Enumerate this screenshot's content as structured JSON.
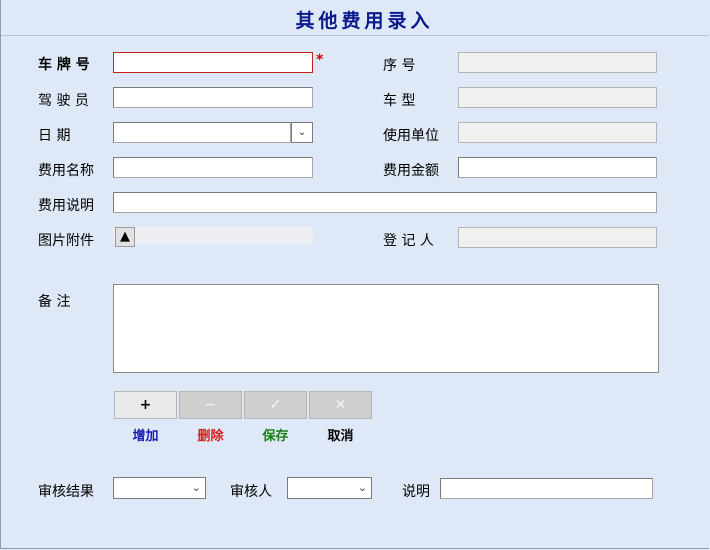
{
  "form": {
    "title": "其他费用录入",
    "fields": {
      "plate_label": "车 牌 号",
      "plate_required_mark": "*",
      "seq_label": "序    号",
      "driver_label": "驾 驶 员",
      "vehicle_type_label": "车    型",
      "date_label": "日    期",
      "user_unit_label": "使用单位",
      "fee_name_label": "费用名称",
      "fee_amount_label": "费用金额",
      "fee_desc_label": "费用说明",
      "attachment_label": "图片附件",
      "registrar_label": "登 记 人",
      "remarks_label": "备    注"
    },
    "upload_arrow": "▲",
    "date_spin_glyph": "⌄"
  },
  "toolbar": {
    "add_icon": "+",
    "delete_icon": "−",
    "save_icon": "✓",
    "cancel_icon": "✕",
    "add_label": "增加",
    "delete_label": "删除",
    "save_label": "保存",
    "cancel_label": "取消",
    "colors": {
      "add": "#1a1ab4",
      "delete": "#d41c1c",
      "save": "#168016",
      "cancel": "#000000"
    }
  },
  "review": {
    "result_label": "审核结果",
    "reviewer_label": "审核人",
    "note_label": "说明",
    "dropdown_glyph": "⌄"
  }
}
